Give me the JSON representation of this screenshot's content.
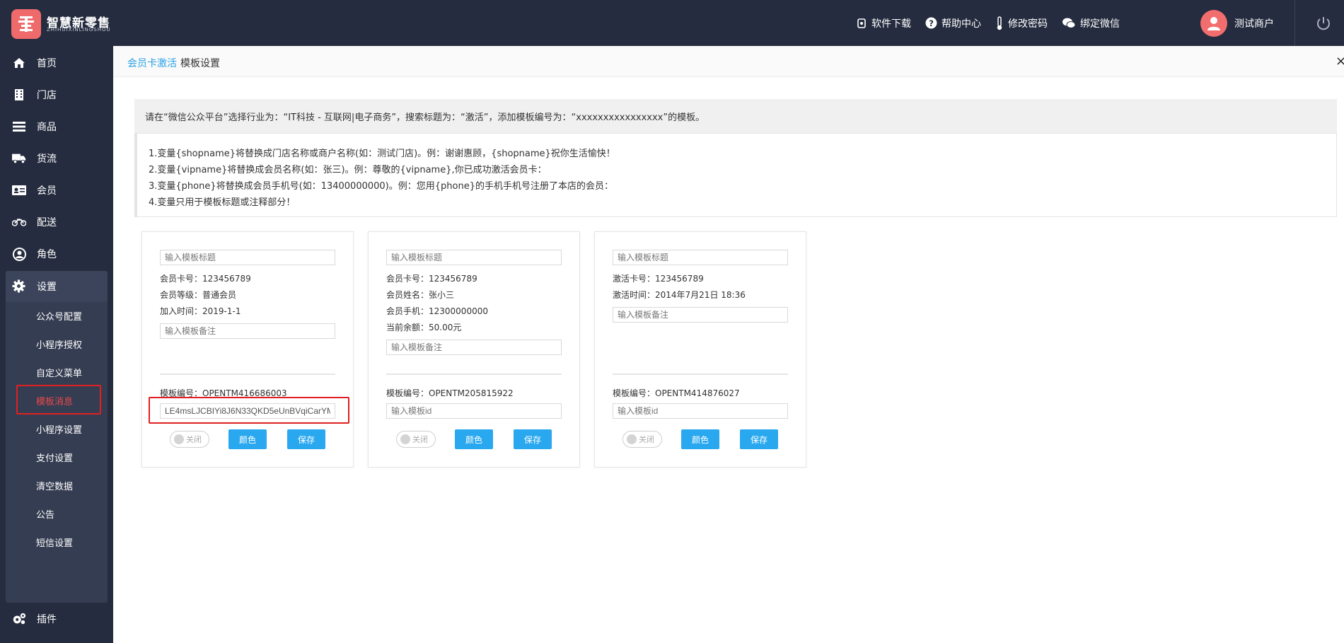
{
  "brand": {
    "name": "智慧新零售",
    "sub": "ZHIHUIXINLINGSHOU"
  },
  "header": {
    "links": [
      {
        "label": "软件下载",
        "icon": "download-icon"
      },
      {
        "label": "帮助中心",
        "icon": "help-icon"
      },
      {
        "label": "修改密码",
        "icon": "thermometer-icon"
      },
      {
        "label": "绑定微信",
        "icon": "wechat-icon"
      }
    ],
    "user_name": "测试商户"
  },
  "sidebar": {
    "items": [
      {
        "label": "首页",
        "icon": "home-icon"
      },
      {
        "label": "门店",
        "icon": "building-icon"
      },
      {
        "label": "商品",
        "icon": "list-icon"
      },
      {
        "label": "货流",
        "icon": "truck-icon"
      },
      {
        "label": "会员",
        "icon": "id-card-icon"
      },
      {
        "label": "配送",
        "icon": "motorcycle-icon"
      },
      {
        "label": "角色",
        "icon": "user-circle-icon"
      },
      {
        "label": "设置",
        "icon": "gear-icon"
      },
      {
        "label": "插件",
        "icon": "gears-icon"
      }
    ],
    "settings_sub": [
      "公众号配置",
      "小程序授权",
      "自定义菜单",
      "模板消息",
      "小程序设置",
      "支付设置",
      "清空数据",
      "公告",
      "短信设置"
    ],
    "active_sub": "模板消息"
  },
  "breadcrumb": {
    "parent": "会员卡激活",
    "current": "模板设置",
    "close": "×"
  },
  "notice": "请在“微信公众平台”选择行业为：“IT科技 - 互联网|电子商务”，搜索标题为：“激活”，添加模板编号为：“xxxxxxxxxxxxxxxx”的模板。",
  "tips": [
    "1.变量{shopname}将替换成门店名称或商户名称(如：测试门店)。例：谢谢惠顾，{shopname}祝你生活愉快！",
    "2.变量{vipname}将替换成会员名称(如：张三)。例：尊敬的{vipname},你已成功激活会员卡：",
    "3.变量{phone}将替换成会员手机号(如：13400000000)。例：您用{phone}的手机手机号注册了本店的会员：",
    "4.变量只用于模板标题或注释部分！"
  ],
  "cards": [
    {
      "title_placeholder": "输入模板标题",
      "lines": [
        "会员卡号：123456789",
        "会员等级：普通会员",
        "加入时间：2019-1-1"
      ],
      "remark_placeholder": "输入模板备注",
      "template_no": "模板编号：OPENTM416686003",
      "id_value": "LE4msLJCBIYi8J6N33QKD5eUnBVqiCarYM",
      "id_placeholder": "输入模板id",
      "toggle": "关闭",
      "color_btn": "颜色",
      "save_btn": "保存"
    },
    {
      "title_placeholder": "输入模板标题",
      "lines": [
        "会员卡号：123456789",
        "会员姓名：张小三",
        "会员手机：12300000000",
        "当前余额：50.00元"
      ],
      "remark_placeholder": "输入模板备注",
      "template_no": "模板编号：OPENTM205815922",
      "id_value": "",
      "id_placeholder": "输入模板id",
      "toggle": "关闭",
      "color_btn": "颜色",
      "save_btn": "保存"
    },
    {
      "title_placeholder": "输入模板标题",
      "lines": [
        "激活卡号：123456789",
        "激活时间：2014年7月21日 18:36"
      ],
      "remark_placeholder": "输入模板备注",
      "template_no": "模板编号：OPENTM414876027",
      "id_value": "",
      "id_placeholder": "输入模板id",
      "toggle": "关闭",
      "color_btn": "颜色",
      "save_btn": "保存"
    }
  ]
}
